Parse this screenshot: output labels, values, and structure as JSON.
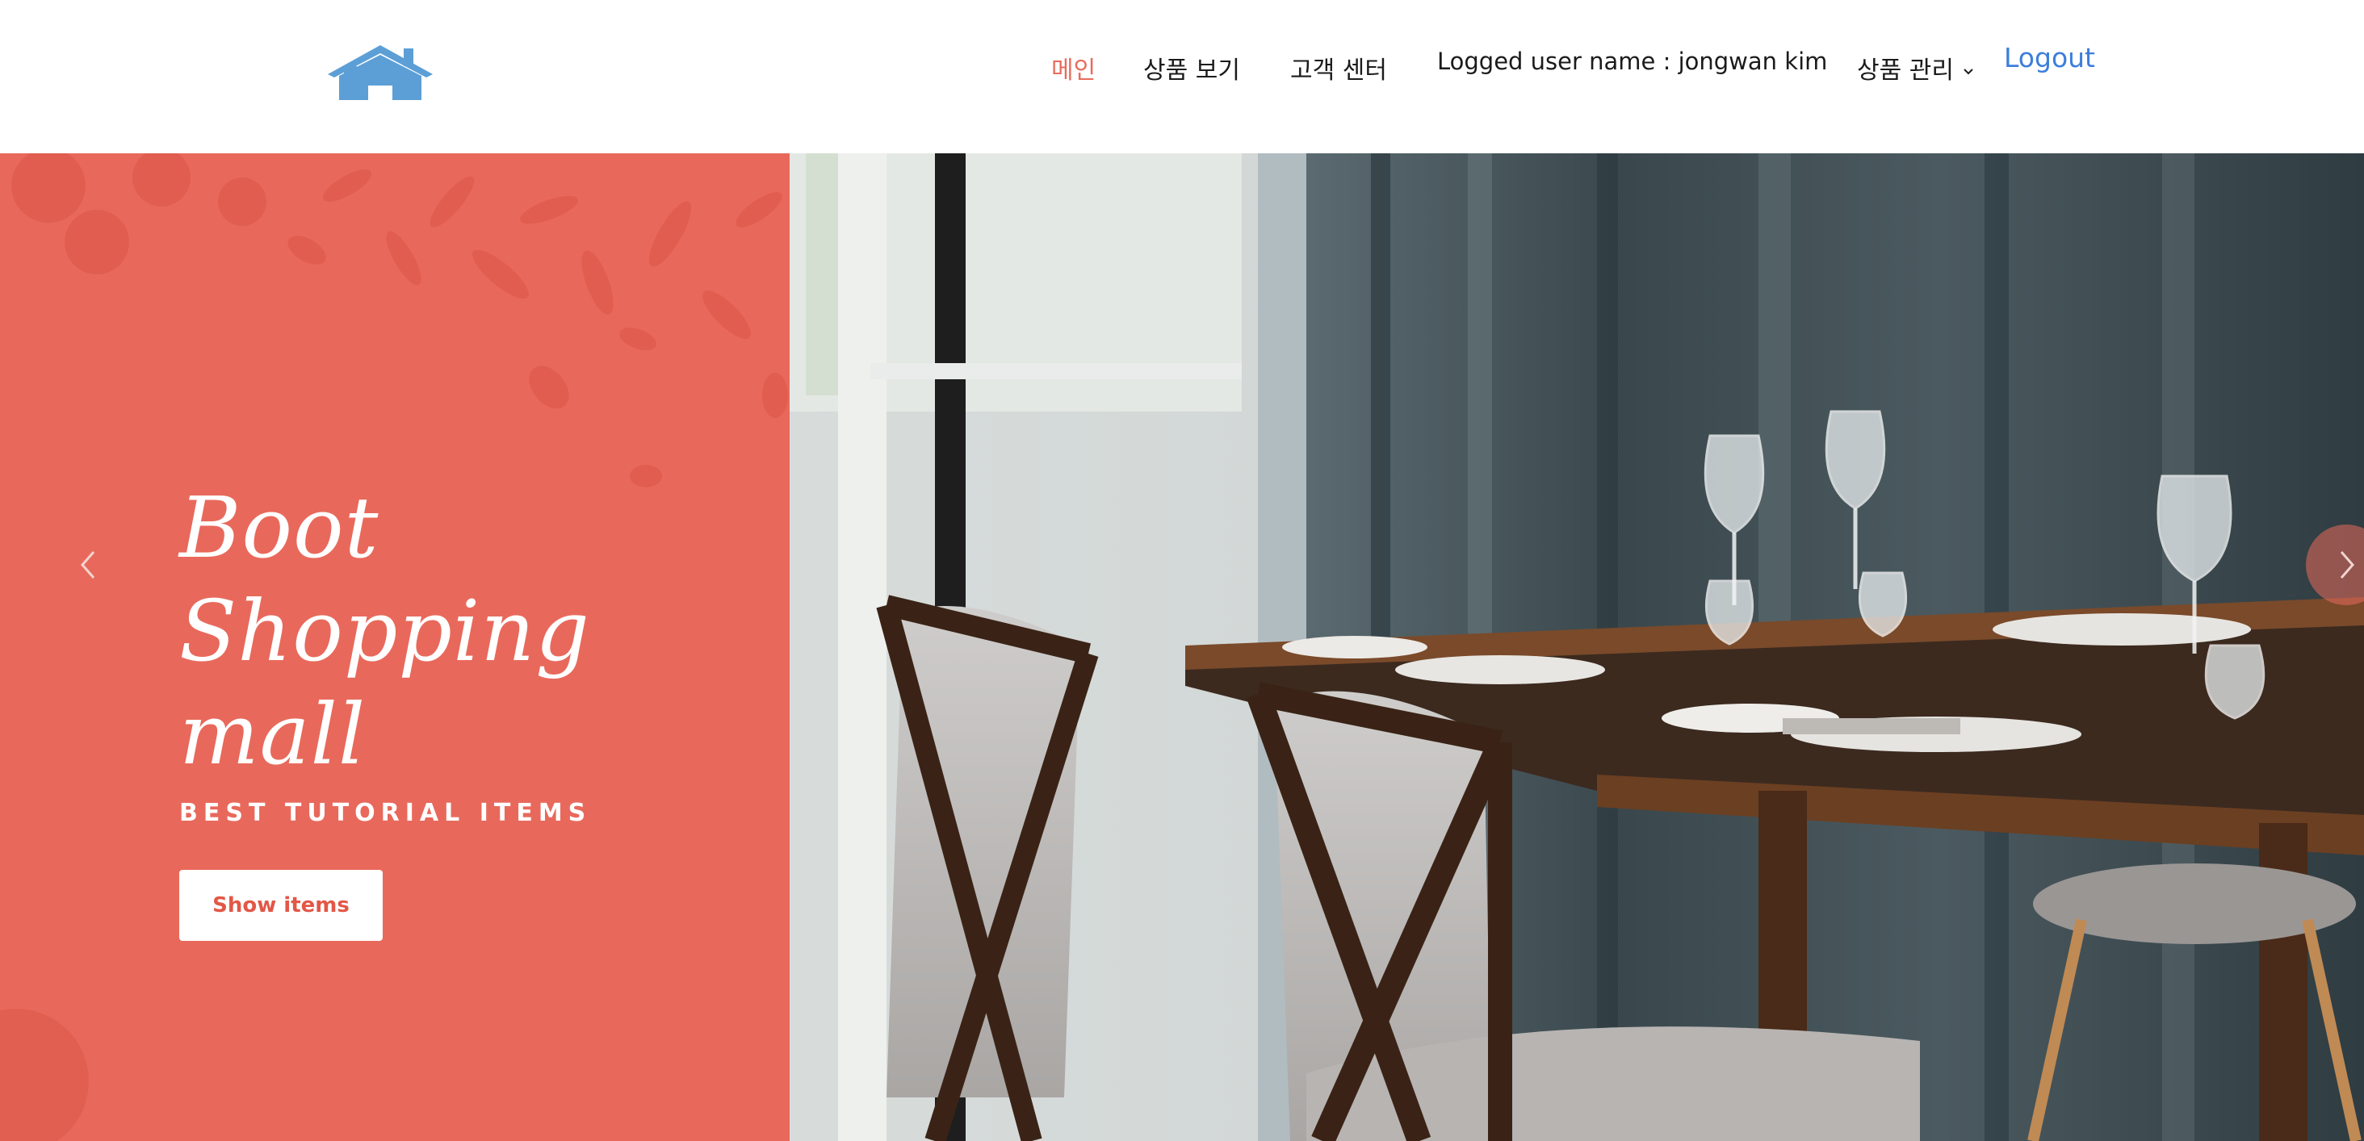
{
  "header": {
    "logo_icon": "house-icon",
    "nav": {
      "main": "메인",
      "products": "상품 보기",
      "support": "고객 센터",
      "user": "Logged user name : jongwan kim",
      "manage": "상품 관리",
      "logout": "Logout"
    },
    "colors": {
      "active": "#e86b5c",
      "logout": "#3d7edb",
      "logo": "#5c9fd6"
    }
  },
  "hero": {
    "title_lines": [
      "Boot",
      "Shopping",
      "mall"
    ],
    "subtitle": "BEST TUTORIAL ITEMS",
    "button_label": "Show items",
    "accent_color": "#e8695b",
    "prev_icon": "chevron-left-icon",
    "next_icon": "chevron-right-icon"
  }
}
